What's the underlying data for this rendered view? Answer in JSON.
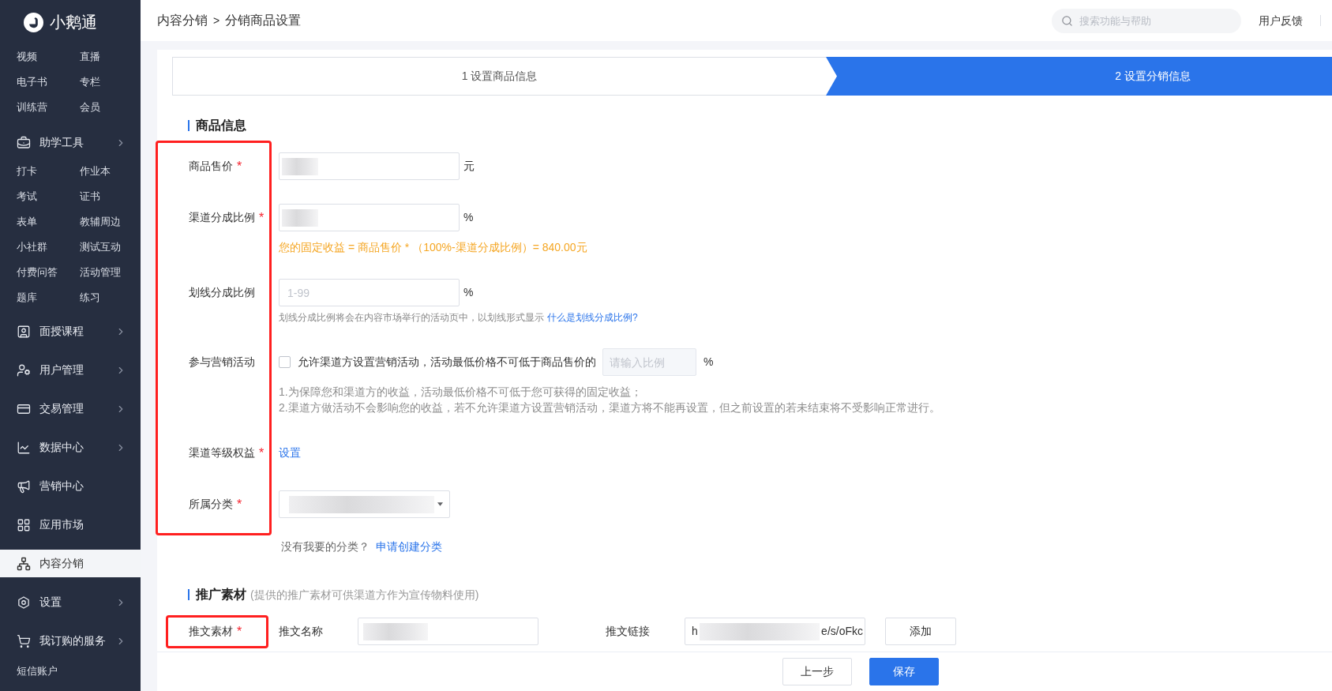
{
  "sidebar": {
    "logo": "小鹅通",
    "sections": [
      {
        "kind": "grid",
        "items": [
          "视频",
          "直播",
          "电子书",
          "专栏",
          "训练营",
          "会员"
        ]
      },
      {
        "kind": "header",
        "label": "助学工具",
        "expandable": true,
        "selected": false
      },
      {
        "kind": "grid",
        "items": [
          "打卡",
          "作业本",
          "考试",
          "证书",
          "表单",
          "教辅周边",
          "小社群",
          "测试互动",
          "付费问答",
          "活动管理",
          "题库",
          "练习"
        ]
      },
      {
        "kind": "menu",
        "label": "面授课程",
        "expandable": true,
        "selected": false
      },
      {
        "kind": "menu",
        "label": "用户管理",
        "expandable": true,
        "selected": false
      },
      {
        "kind": "menu",
        "label": "交易管理",
        "expandable": true,
        "selected": false
      },
      {
        "kind": "menu",
        "label": "数据中心",
        "expandable": true,
        "selected": false
      },
      {
        "kind": "menu",
        "label": "营销中心",
        "expandable": false,
        "selected": false
      },
      {
        "kind": "menu",
        "label": "应用市场",
        "expandable": false,
        "selected": false
      },
      {
        "kind": "menu",
        "label": "内容分销",
        "expandable": false,
        "selected": true
      },
      {
        "kind": "menu",
        "label": "设置",
        "expandable": true,
        "selected": false
      },
      {
        "kind": "menu",
        "label": "我订购的服务",
        "expandable": true,
        "selected": false
      },
      {
        "kind": "grid",
        "items": [
          "短信账户"
        ]
      }
    ]
  },
  "topbar": {
    "breadcrumb": [
      "内容分销",
      "分销商品设置"
    ],
    "separator": ">",
    "search": {
      "placeholder": "搜索功能与帮助"
    },
    "links": [
      "用户反馈"
    ]
  },
  "steps": [
    {
      "label": "1 设置商品信息",
      "active": false
    },
    {
      "label": "2 设置分销信息",
      "active": true
    }
  ],
  "sections": [
    {
      "title": "商品信息",
      "fields": [
        {
          "kind": "input",
          "label": "商品售价",
          "required_mark": "*",
          "redacted": true,
          "suffix": "元"
        },
        {
          "kind": "input",
          "label": "渠道分成比例",
          "required_mark": "*",
          "redacted": true,
          "suffix": "%",
          "note": "您的固定收益 = 商品售价 * （100%-渠道分成比例）= 840.00元"
        },
        {
          "kind": "input",
          "label": "划线分成比例",
          "placeholder": "1-99",
          "suffix": "%",
          "hint": "划线分成比例将会在内容市场举行的活动页中，以划线形式显示",
          "hint_link": "什么是划线分成比例?"
        },
        {
          "kind": "checkbox",
          "label": "参与营销活动",
          "checked": false,
          "text": "允许渠道方设置营销活动，活动最低价格不可低于商品售价的",
          "placeholder": "请输入比例",
          "suffix": "%",
          "notes": [
            "1.为保障您和渠道方的收益，活动最低价格不可低于您可获得的固定收益；",
            "2.渠道方做活动不会影响您的收益，若不允许渠道方设置营销活动，渠道方将不能再设置，但之前设置的若未结束将不受影响正常进行。"
          ]
        },
        {
          "kind": "link",
          "label": "渠道等级权益",
          "required_mark": "*",
          "link": "设置"
        },
        {
          "kind": "select",
          "label": "所属分类",
          "required_mark": "*",
          "redacted": true,
          "hint": "没有我要的分类？",
          "hint_link": "申请创建分类"
        }
      ]
    },
    {
      "title": "推广素材",
      "subtitle": "(提供的推广素材可供渠道方作为宣传物料使用)",
      "fields": [
        {
          "kind": "pair",
          "label": "推文素材",
          "required_mark": "*",
          "name_label": "推文名称",
          "name_redacted": true,
          "link_label": "推文链接",
          "link_value_start": "h",
          "link_value_end": "e/s/oFkc",
          "button": "添加"
        }
      ]
    }
  ],
  "footer": {
    "buttons": [
      {
        "label": "上一步",
        "kind": "default"
      },
      {
        "label": "保存",
        "kind": "primary"
      }
    ]
  }
}
